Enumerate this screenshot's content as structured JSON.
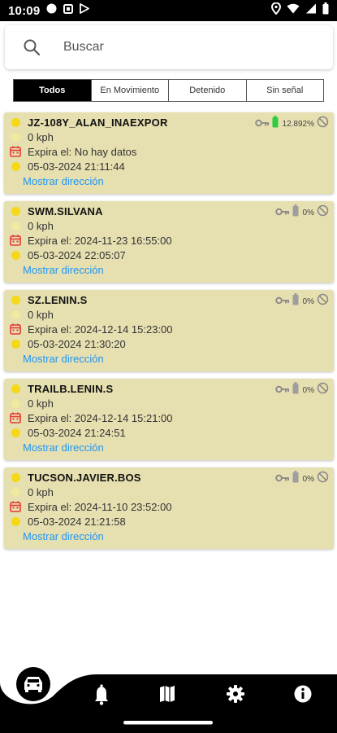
{
  "status_bar": {
    "time": "10:09"
  },
  "search": {
    "placeholder": "Buscar"
  },
  "filters": [
    {
      "label": "Todos",
      "active": true
    },
    {
      "label": "En Movimiento",
      "active": false
    },
    {
      "label": "Detenido",
      "active": false
    },
    {
      "label": "Sin señal",
      "active": false
    }
  ],
  "vehicles": [
    {
      "name": "JZ-108Y_ALAN_INAEXPOR",
      "speed": "0 kph",
      "expiry": "Expira el: No hay datos",
      "timestamp": "05-03-2024 21:11:44",
      "link": "Mostrar dirección",
      "battery": "12.892%",
      "battery_color": "#2ecc40"
    },
    {
      "name": "SWM.SILVANA",
      "speed": "0 kph",
      "expiry": "Expira el: 2024-11-23 16:55:00",
      "timestamp": "05-03-2024 22:05:07",
      "link": "Mostrar dirección",
      "battery": "0%",
      "battery_color": "#9e9e9e"
    },
    {
      "name": "SZ.LENIN.S",
      "speed": "0 kph",
      "expiry": "Expira el: 2024-12-14 15:23:00",
      "timestamp": "05-03-2024 21:30:20",
      "link": "Mostrar dirección",
      "battery": "0%",
      "battery_color": "#9e9e9e"
    },
    {
      "name": "TRAILB.LENIN.S",
      "speed": "0 kph",
      "expiry": "Expira el: 2024-12-14 15:21:00",
      "timestamp": "05-03-2024 21:24:51",
      "link": "Mostrar dirección",
      "battery": "0%",
      "battery_color": "#9e9e9e"
    },
    {
      "name": "TUCSON.JAVIER.BOS",
      "speed": "0 kph",
      "expiry": "Expira el: 2024-11-10 23:52:00",
      "timestamp": "05-03-2024 21:21:58",
      "link": "Mostrar dirección",
      "battery": "0%",
      "battery_color": "#9e9e9e"
    }
  ],
  "colors": {
    "card_bg": "#e6dfb0",
    "link": "#2196f3",
    "active_filter": "#000000",
    "calendar": "#e53935",
    "sun": "#f5d816"
  },
  "bottom_nav": {
    "icons": [
      "car-icon",
      "bell-icon",
      "map-icon",
      "gear-icon",
      "info-icon"
    ],
    "active": "car-icon"
  }
}
